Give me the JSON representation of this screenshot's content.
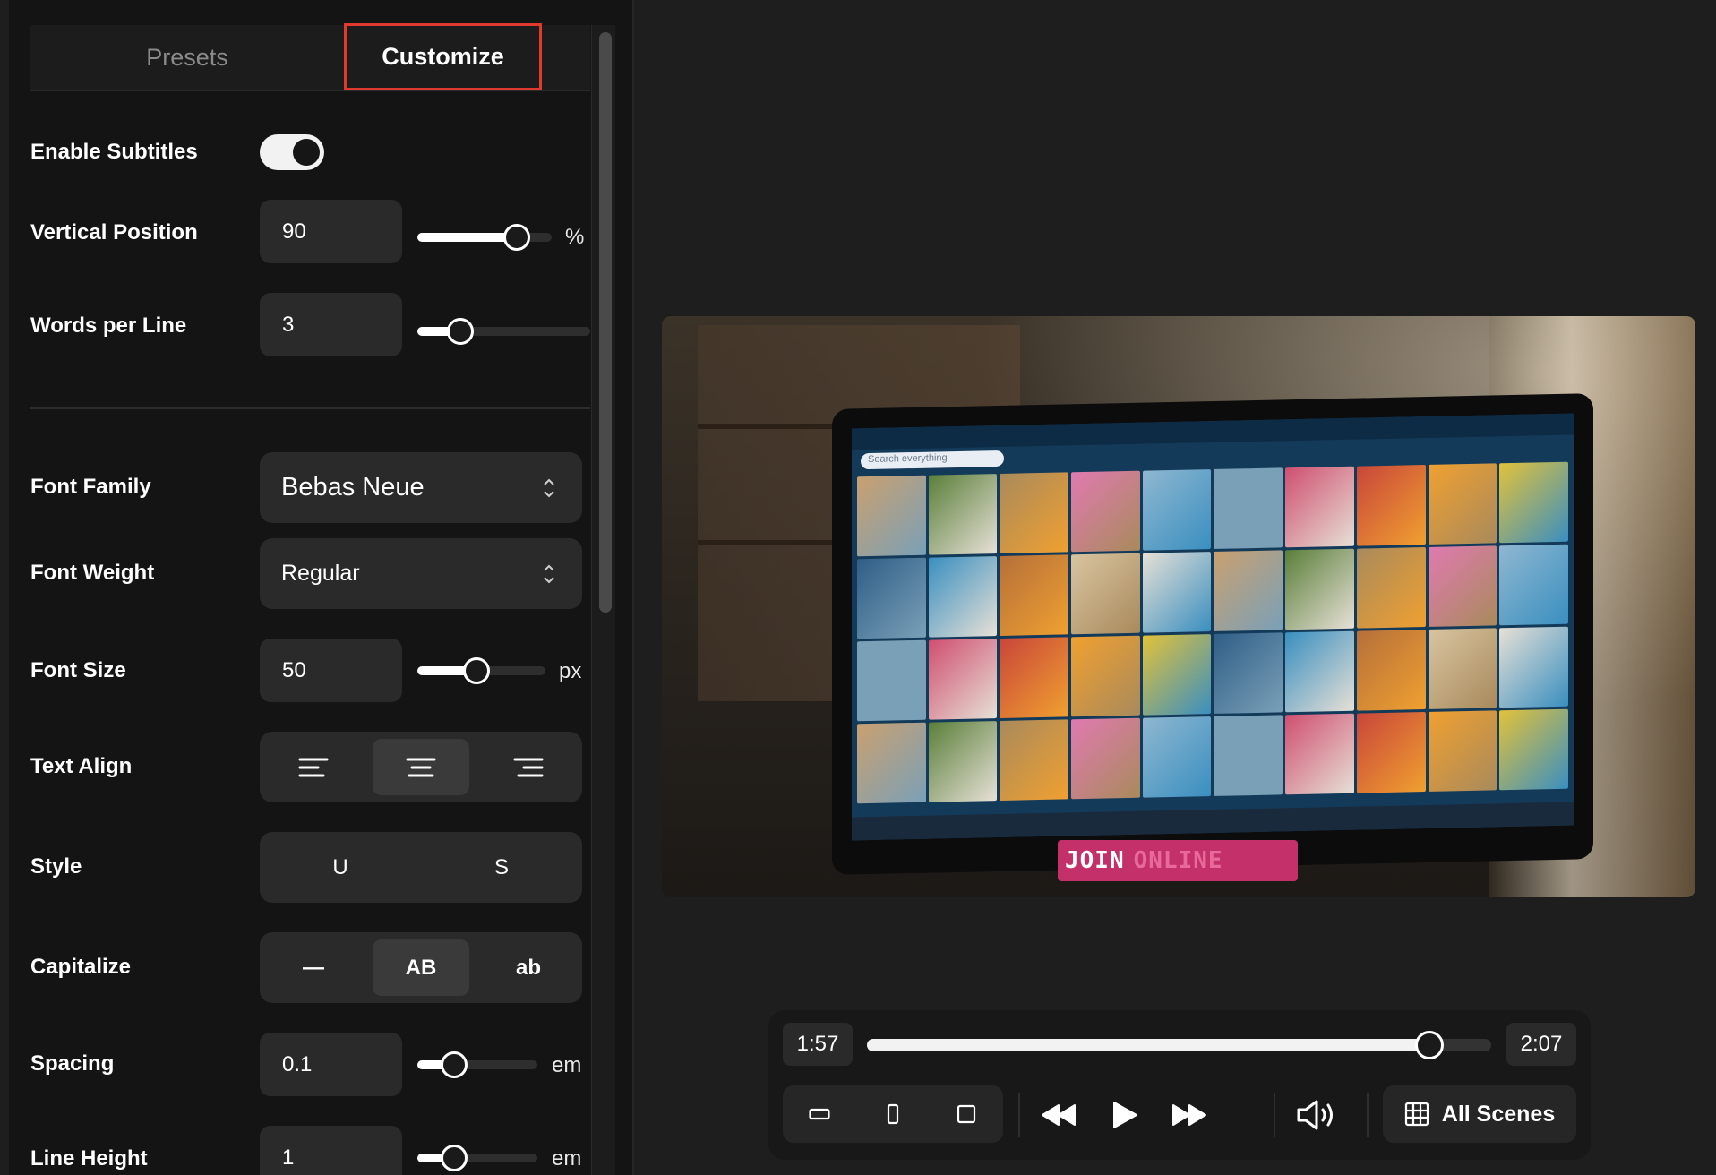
{
  "tabs": {
    "presets": "Presets",
    "customize": "Customize",
    "active": "customize"
  },
  "settings": {
    "enable_subtitles": {
      "label": "Enable Subtitles",
      "value": true
    },
    "vertical_position": {
      "label": "Vertical Position",
      "value": "90",
      "unit": "%",
      "slider_fraction": 0.8
    },
    "words_per_line": {
      "label": "Words per Line",
      "value": "3",
      "slider_fraction": 0.2
    },
    "font_family": {
      "label": "Font Family",
      "value": "Bebas Neue"
    },
    "font_weight": {
      "label": "Font Weight",
      "value": "Regular"
    },
    "font_size": {
      "label": "Font Size",
      "value": "50",
      "unit": "px",
      "slider_fraction": 0.45
    },
    "text_align": {
      "label": "Text Align",
      "options": [
        "left",
        "center",
        "right"
      ],
      "selected": "center"
    },
    "style": {
      "label": "Style",
      "options": [
        "U",
        "S"
      ]
    },
    "capitalize": {
      "label": "Capitalize",
      "options": [
        "—",
        "AB",
        "ab"
      ],
      "selected": "AB"
    },
    "spacing": {
      "label": "Spacing",
      "value": "0.1",
      "unit": "em",
      "slider_fraction": 0.25
    },
    "line_height": {
      "label": "Line Height",
      "value": "1",
      "unit": "em",
      "slider_fraction": 0.25
    }
  },
  "preview": {
    "subtitle_words": [
      "JOIN",
      "ONLINE"
    ],
    "subtitle_highlight_color": "#c3306a",
    "search_text": "Search everything"
  },
  "player": {
    "current_time": "1:57",
    "total_time": "2:07",
    "progress_fraction": 0.92,
    "aspect_buttons": [
      "landscape-icon",
      "portrait-icon",
      "square-icon"
    ],
    "scenes_label": "All Scenes"
  },
  "colors": {
    "accent_border": "#e03a2f",
    "panel_bg": "#141414",
    "page_bg": "#1e1e1e"
  }
}
